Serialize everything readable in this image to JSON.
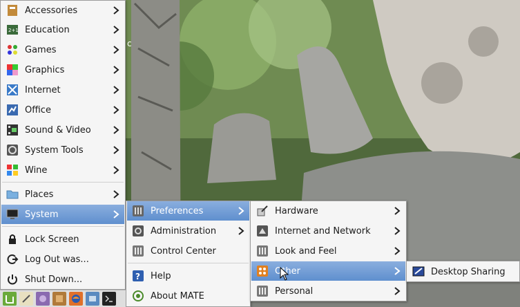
{
  "applications_menu": [
    {
      "label": "Accessories",
      "icon": "accessories-icon"
    },
    {
      "label": "Education",
      "icon": "education-icon"
    },
    {
      "label": "Games",
      "icon": "games-icon"
    },
    {
      "label": "Graphics",
      "icon": "graphics-icon"
    },
    {
      "label": "Internet",
      "icon": "internet-icon"
    },
    {
      "label": "Office",
      "icon": "office-icon"
    },
    {
      "label": "Sound & Video",
      "icon": "sound-video-icon"
    },
    {
      "label": "System Tools",
      "icon": "system-tools-icon"
    },
    {
      "label": "Wine",
      "icon": "wine-icon"
    },
    {
      "label": "Places",
      "icon": "folder-icon"
    },
    {
      "label": "System",
      "icon": "monitor-icon"
    },
    {
      "label": "Lock Screen",
      "icon": "lock-icon"
    },
    {
      "label": "Log Out was...",
      "icon": "logout-icon"
    },
    {
      "label": "Shut Down...",
      "icon": "power-icon"
    }
  ],
  "system_menu": [
    {
      "label": "Preferences"
    },
    {
      "label": "Administration"
    },
    {
      "label": "Control Center"
    },
    {
      "label": "Help"
    },
    {
      "label": "About MATE"
    }
  ],
  "preferences_menu": [
    {
      "label": "Hardware"
    },
    {
      "label": "Internet and Network"
    },
    {
      "label": "Look and Feel"
    },
    {
      "label": "Other"
    },
    {
      "label": "Personal"
    }
  ],
  "other_menu": [
    {
      "label": "Desktop Sharing"
    }
  ],
  "desktop_label": "c",
  "colors": {
    "highlight_top": "#8aaede",
    "highlight_bottom": "#5f8fce",
    "menu_bg": "#f5f5f5"
  }
}
